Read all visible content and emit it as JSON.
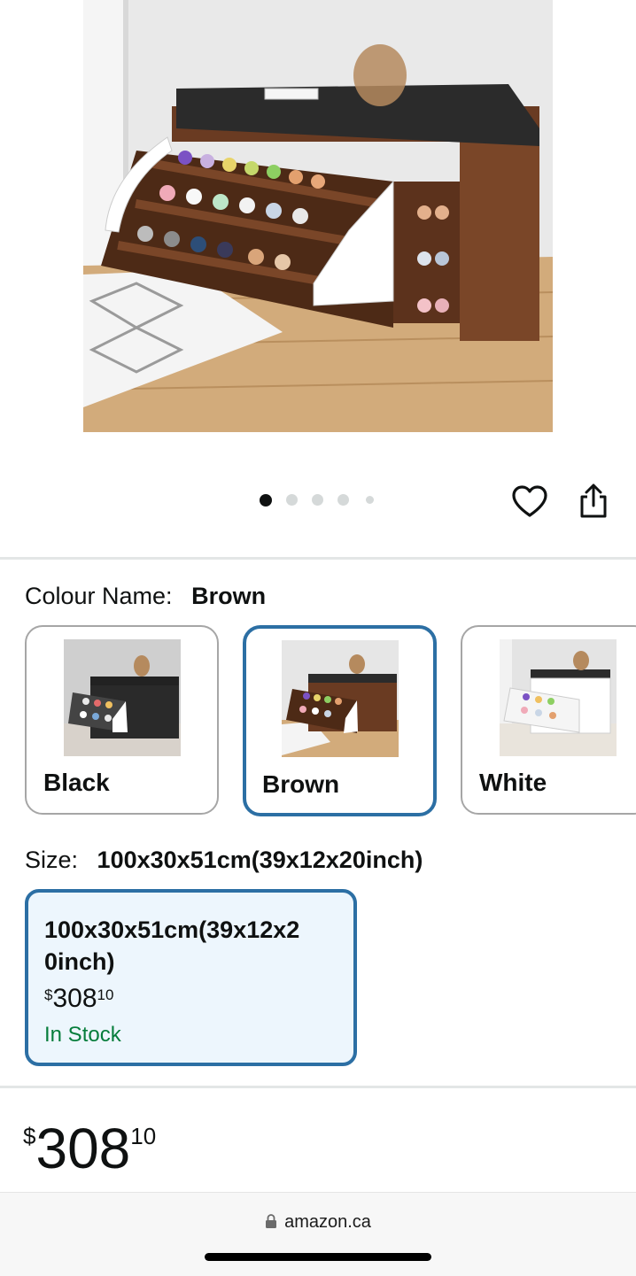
{
  "gallery": {
    "dots_total": 5,
    "active_index": 0
  },
  "colour": {
    "label": "Colour Name:",
    "selected": "Brown",
    "options": [
      {
        "label": "Black"
      },
      {
        "label": "Brown"
      },
      {
        "label": "White"
      }
    ]
  },
  "size": {
    "label": "Size:",
    "selected": "100x30x51cm(39x12x20inch)",
    "option": {
      "line1": "100x30x51cm(39x12x2",
      "line2": "0inch)",
      "currency": "$",
      "price_whole": "308",
      "price_fraction": "10",
      "stock": "In Stock"
    }
  },
  "price": {
    "currency": "$",
    "whole": "308",
    "fraction": "10"
  },
  "browser": {
    "domain": "amazon.ca"
  },
  "colors": {
    "selected_border": "#2c6fa4",
    "in_stock": "#067d3b",
    "size_card_bg": "#edf6fd"
  }
}
